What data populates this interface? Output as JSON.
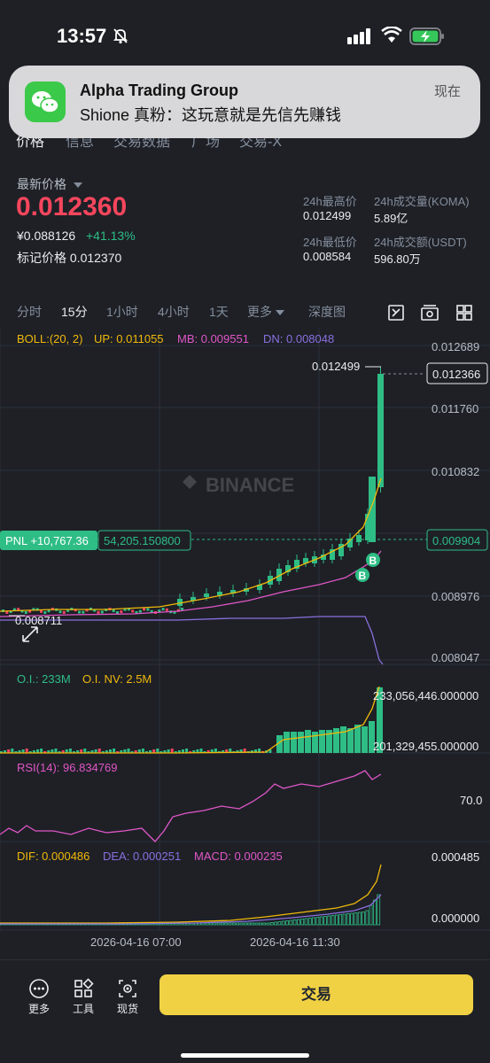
{
  "status_bar": {
    "time": "13:57"
  },
  "notification": {
    "title": "Alpha Trading Group",
    "body": "Shione 真粉：这玩意就是先信先赚钱",
    "time": "现在"
  },
  "tabs": [
    "价格",
    "信息",
    "交易数据",
    "广场",
    "交易-X"
  ],
  "price": {
    "label": "最新价格",
    "last": "0.012360",
    "cny": "¥0.088126",
    "change": "+41.13%",
    "mark": "标记价格 0.012370"
  },
  "stats": {
    "high_label": "24h最高价",
    "high": "0.012499",
    "low_label": "24h最低价",
    "low": "0.008584",
    "vol_label": "24h成交量(KOMA)",
    "vol": "5.89亿",
    "amt_label": "24h成交额(USDT)",
    "amt": "596.80万"
  },
  "intervals": [
    "分时",
    "15分",
    "1小时",
    "4小时",
    "1天",
    "更多",
    "深度图"
  ],
  "chart": {
    "boll": {
      "label": "BOLL:(20, 2)",
      "up": "UP: 0.011055",
      "mb": "MB: 0.009551",
      "dn": "DN: 0.008048"
    },
    "y_ticks": [
      "0.012689",
      "0.011760",
      "0.010832",
      "0.008976",
      "0.008047"
    ],
    "current_price": "0.012366",
    "pnl_price": "0.009904",
    "high_marker": "0.012499",
    "low_marker": "0.008711",
    "pnl_label": "PNL +10,767.36",
    "pnl_qty": "54,205.150800",
    "watermark": "BINANCE",
    "buy_marker": "B",
    "oi": {
      "label": "O.I.: 233M",
      "nv": "O.I. NV: 2.5M",
      "top": "233,056,446.000000",
      "bottom": "201,329,455.000000"
    },
    "rsi": {
      "label": "RSI(14): 96.834769",
      "tick": "70.0"
    },
    "macd": {
      "dif": "DIF: 0.000486",
      "dea": "DEA: 0.000251",
      "macd": "MACD: 0.000235",
      "top": "0.000485",
      "zero": "0.000000"
    },
    "x_labels": [
      "2026-04-16 07:00",
      "2026-04-16 11:30"
    ],
    "colors": {
      "up": "#2ebd85",
      "down": "#f6465d",
      "boll_up": "#f0b90b",
      "boll_mb": "#e056c7",
      "boll_dn": "#8a6fdf"
    }
  },
  "bottom_bar": {
    "more": "更多",
    "tools": "工具",
    "spot": "现货",
    "trade": "交易"
  }
}
